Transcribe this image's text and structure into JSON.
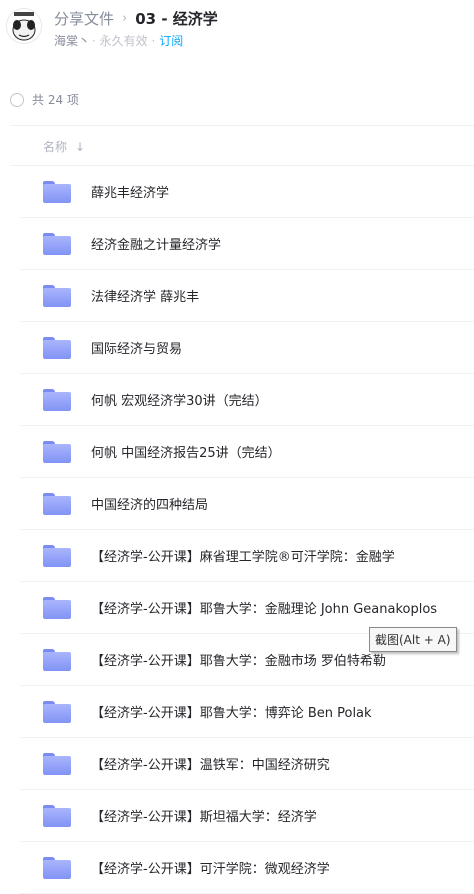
{
  "header": {
    "breadcrumb_parent": "分享文件",
    "breadcrumb_current": "03 - 经济学",
    "sharer": "海棠丶",
    "validity": "· 永久有效 ·",
    "subscribe": "订阅"
  },
  "list_summary": {
    "count_text": "共 24 项"
  },
  "columns": {
    "name": "名称"
  },
  "files": [
    {
      "name": "薛兆丰经济学",
      "icon": "folder-icon"
    },
    {
      "name": "经济金融之计量经济学",
      "icon": "folder-icon"
    },
    {
      "name": "法律经济学 薛兆丰",
      "icon": "folder-icon"
    },
    {
      "name": "国际经济与贸易",
      "icon": "folder-icon"
    },
    {
      "name": "何帆 宏观经济学30讲（完结）",
      "icon": "folder-icon"
    },
    {
      "name": "何帆 中国经济报告25讲（完结）",
      "icon": "folder-icon"
    },
    {
      "name": "中国经济的四种结局",
      "icon": "folder-icon"
    },
    {
      "name": "【经济学-公开课】麻省理工学院®可汗学院：金融学",
      "icon": "folder-icon"
    },
    {
      "name": "【经济学-公开课】耶鲁大学：金融理论 John Geanakoplos",
      "icon": "folder-icon"
    },
    {
      "name": "【经济学-公开课】耶鲁大学：金融市场 罗伯特希勒",
      "icon": "folder-icon"
    },
    {
      "name": "【经济学-公开课】耶鲁大学：博弈论 Ben Polak",
      "icon": "folder-icon"
    },
    {
      "name": "【经济学-公开课】温铁军：中国经济研究",
      "icon": "folder-icon"
    },
    {
      "name": "【经济学-公开课】斯坦福大学：经济学",
      "icon": "folder-icon"
    },
    {
      "name": "【经济学-公开课】可汗学院：微观经济学",
      "icon": "folder-icon"
    }
  ],
  "tooltip": {
    "text": "截图(Alt + A)"
  },
  "colors": {
    "accent": "#06a7ff",
    "folder": "#8d9cf7"
  }
}
